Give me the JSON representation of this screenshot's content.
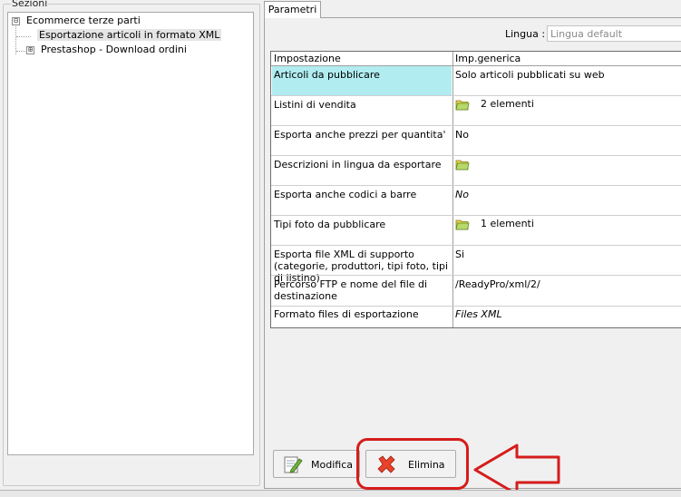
{
  "sidebar": {
    "title": "Sezioni",
    "tree": [
      {
        "label": "Ecommerce terze parti",
        "expander": "⊟",
        "children": [
          {
            "label": "Esportazione articoli in formato XML",
            "selected": true
          }
        ]
      },
      {
        "label": "Prestashop - Download ordini",
        "expander": "⊞"
      }
    ]
  },
  "tabs": [
    {
      "label": "Parametri",
      "active": true
    }
  ],
  "lingua": {
    "label": "Lingua :",
    "placeholder": "Lingua default"
  },
  "grid": {
    "headers": [
      "Impostazione",
      "Imp.generica"
    ],
    "rows": [
      {
        "label": "Articoli da pubblicare",
        "value": "Solo articoli pubblicati su web",
        "selected": true
      },
      {
        "label": "Listini di vendita",
        "value": "2 elementi",
        "icon": "folder-icon"
      },
      {
        "label": "Esporta anche prezzi per quantita'",
        "value": "No"
      },
      {
        "label": "Descrizioni in lingua da esportare",
        "value": "",
        "icon": "folder-icon"
      },
      {
        "label": "Esporta anche codici a barre",
        "value": "No",
        "italic": true
      },
      {
        "label": "Tipi foto da pubblicare",
        "value": "1 elementi",
        "icon": "folder-icon"
      },
      {
        "label": "Esporta file XML di supporto (categorie, produttori, tipi foto, tipi di listino)",
        "value": "Si"
      },
      {
        "label": "Percorso FTP e nome del file di destinazione",
        "value": "/ReadyPro/xml/2/"
      },
      {
        "label": "Formato files di esportazione",
        "value": "Files XML",
        "italic": true
      }
    ]
  },
  "buttons": {
    "modifica": {
      "label": "Modifica",
      "icon": "edit-icon"
    },
    "elimina": {
      "label": "Elimina",
      "icon": "delete-x-icon"
    }
  },
  "colors": {
    "selection": "#b0ecf0",
    "annotation": "#d61c1c",
    "delete": "#e8432a"
  }
}
